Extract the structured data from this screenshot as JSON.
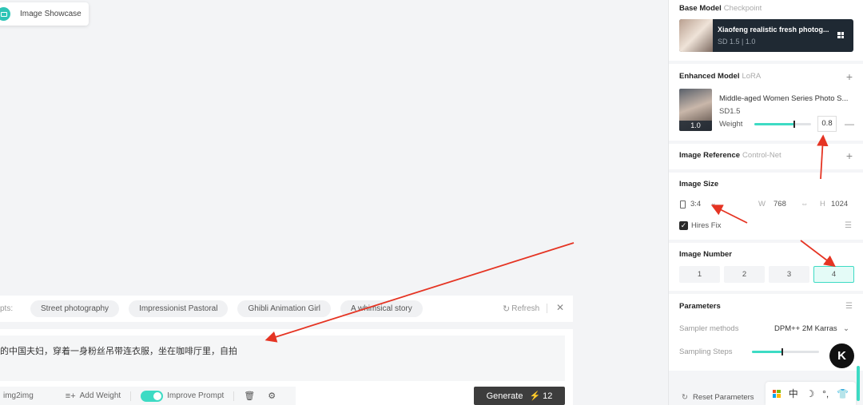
{
  "showcase": {
    "label": "Image Showcase"
  },
  "suggestions": {
    "prefix": "pts:",
    "chips": [
      "Street photography",
      "Impressionist Pastoral",
      "Ghibli Animation Girl",
      "A whimsical story"
    ],
    "refresh_label": "Refresh",
    "close": "✕"
  },
  "prompt": {
    "text": "的中国夫妇，穿着一身粉丝吊带连衣服，坐在咖啡厅里，自拍"
  },
  "toolbar": {
    "img2img": "img2img",
    "add_weight": "Add Weight",
    "improve_prompt": "Improve Prompt",
    "generate_label": "Generate",
    "generate_cost": "12"
  },
  "base_model": {
    "title": "Base Model",
    "subtitle": "Checkpoint",
    "name": "Xiaofeng realistic fresh photog...",
    "version": "SD 1.5  |  1.0"
  },
  "enhanced_model": {
    "title": "Enhanced Model",
    "subtitle": "LoRA",
    "name": "Middle-aged Women Series Photo S...",
    "version": "SD1.5",
    "thumb_badge": "1.0",
    "weight_label": "Weight",
    "weight_value": "0.8",
    "weight_fraction": 0.7
  },
  "image_reference": {
    "title": "Image Reference",
    "subtitle": "Control-Net"
  },
  "image_size": {
    "title": "Image Size",
    "ratio": "3:4",
    "w_label": "W",
    "width": "768",
    "h_label": "H",
    "height": "1024",
    "hires_label": "Hires Fix"
  },
  "image_number": {
    "title": "Image Number",
    "options": [
      "1",
      "2",
      "3",
      "4"
    ],
    "selected": "4"
  },
  "parameters": {
    "title": "Parameters",
    "sampler_label": "Sampler methods",
    "sampler_value": "DPM++ 2M Karras",
    "steps_label": "Sampling Steps",
    "steps_fraction": 0.45
  },
  "reset_label": "Reset Parameters",
  "colors": {
    "accent": "#3ddbc4",
    "arrow": "#e53423",
    "generate_bg": "#3d3d3d"
  }
}
